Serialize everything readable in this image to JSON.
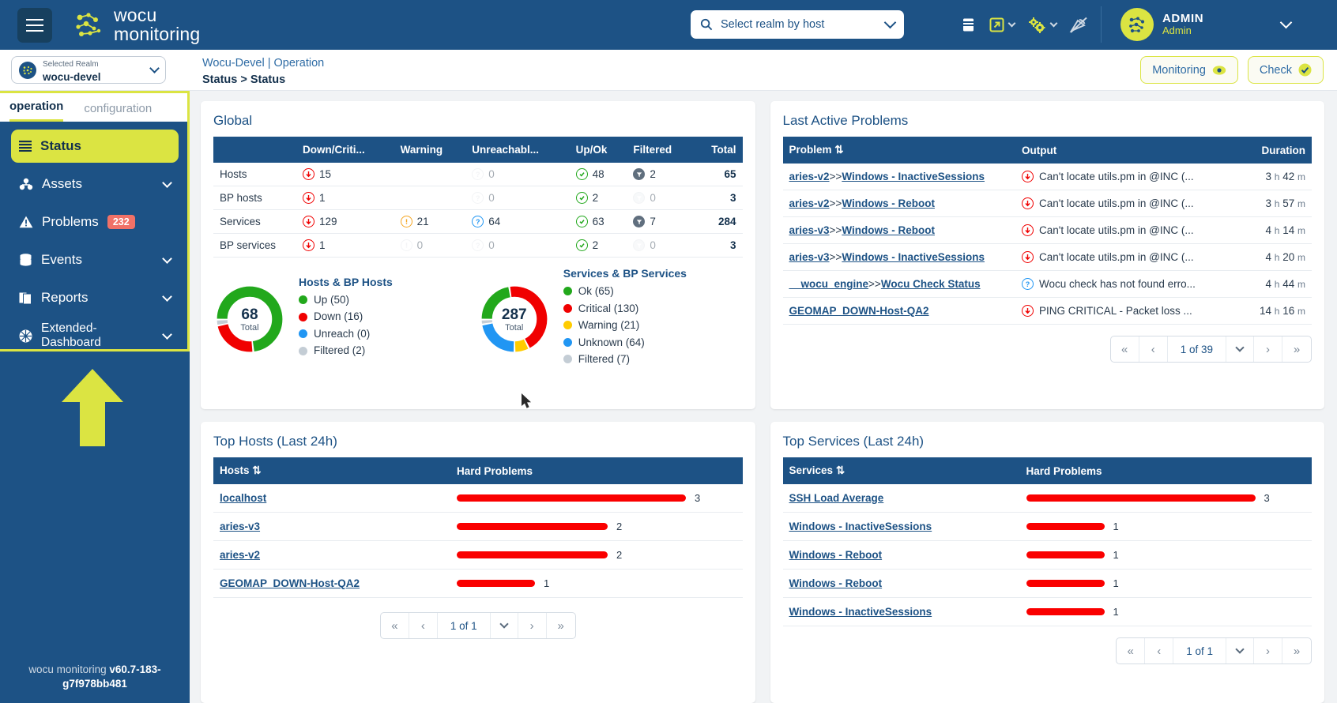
{
  "header": {
    "brand_line1": "wocu",
    "brand_line2": "monitoring",
    "search_placeholder": "Select realm by host",
    "icons": {
      "menu": "hamburger-menu-icon",
      "search": "search-icon",
      "book": "book-icon",
      "external": "external-link-icon",
      "gears": "gears-icon",
      "satellite": "satellite-off-icon"
    },
    "user_name": "ADMIN",
    "user_role": "Admin"
  },
  "subheader": {
    "realm_label": "Selected Realm",
    "realm_value": "wocu-devel",
    "breadcrumb_top": "Wocu-Devel | Operation",
    "breadcrumb_bottom": "Status > Status",
    "btn_monitoring": "Monitoring",
    "btn_check": "Check"
  },
  "sidebar": {
    "tabs": [
      {
        "label": "operation",
        "active": true
      },
      {
        "label": "configuration",
        "active": false
      }
    ],
    "items": [
      {
        "label": "Status",
        "icon": "list-icon",
        "active": true,
        "badge": null,
        "chevron": false
      },
      {
        "label": "Assets",
        "icon": "assets-icon",
        "active": false,
        "badge": null,
        "chevron": true
      },
      {
        "label": "Problems",
        "icon": "warning-triangle-icon",
        "active": false,
        "badge": "232",
        "chevron": false
      },
      {
        "label": "Events",
        "icon": "database-icon",
        "active": false,
        "badge": null,
        "chevron": true
      },
      {
        "label": "Reports",
        "icon": "document-icon",
        "active": false,
        "badge": null,
        "chevron": true
      },
      {
        "label": "Extended-Dashboard",
        "icon": "dashboard-icon",
        "active": false,
        "badge": null,
        "chevron": true
      }
    ],
    "version_prefix": "wocu monitoring ",
    "version": "v60.7-183-g7f978bb481"
  },
  "global": {
    "title": "Global",
    "columns": [
      "",
      "Down/Criti...",
      "Warning",
      "Unreachabl...",
      "Up/Ok",
      "Filtered",
      "Total"
    ],
    "rows": [
      {
        "name": "Hosts",
        "down": "15",
        "warning": "",
        "unreach": "0",
        "up": "48",
        "filtered": "2",
        "total": "65"
      },
      {
        "name": "BP hosts",
        "down": "1",
        "warning": "",
        "unreach": "0",
        "up": "2",
        "filtered": "0",
        "total": "3"
      },
      {
        "name": "Services",
        "down": "129",
        "warning": "21",
        "unreach": "64",
        "up": "63",
        "filtered": "7",
        "total": "284"
      },
      {
        "name": "BP services",
        "down": "1",
        "warning": "0",
        "unreach": "0",
        "up": "2",
        "filtered": "0",
        "total": "3"
      }
    ]
  },
  "chart_data": [
    {
      "type": "pie",
      "title": "Hosts & BP Hosts",
      "center_value": "68",
      "center_label": "Total",
      "categories": [
        "Up",
        "Down",
        "Unreach",
        "Filtered"
      ],
      "values": [
        50,
        16,
        0,
        2
      ],
      "labels": [
        "Up (50)",
        "Down (16)",
        "Unreach (0)",
        "Filtered (2)"
      ],
      "colors": [
        "#22a81c",
        "#f00000",
        "#2196f3",
        "#c4cdd5"
      ],
      "legend": "right"
    },
    {
      "type": "pie",
      "title": "Services & BP Services",
      "center_value": "287",
      "center_label": "Total",
      "categories": [
        "Ok",
        "Critical",
        "Warning",
        "Unknown",
        "Filtered"
      ],
      "values": [
        65,
        130,
        21,
        64,
        7
      ],
      "labels": [
        "Ok (65)",
        "Critical (130)",
        "Warning (21)",
        "Unknown (64)",
        "Filtered (7)"
      ],
      "colors": [
        "#22a81c",
        "#f00000",
        "#ffcc00",
        "#2196f3",
        "#c4cdd5"
      ],
      "legend": "right"
    }
  ],
  "problems": {
    "title": "Last Active Problems",
    "columns": [
      "Problem",
      "Output",
      "Duration"
    ],
    "rows": [
      {
        "host": "aries-v2",
        "sep": ">>",
        "service": "Windows - InactiveSessions",
        "status": "critical",
        "output": "Can't locate utils.pm in @INC (...",
        "hours": "3",
        "mins": "42"
      },
      {
        "host": "aries-v2",
        "sep": ">>",
        "service": "Windows - Reboot",
        "status": "critical",
        "output": "Can't locate utils.pm in @INC (...",
        "hours": "3",
        "mins": "57"
      },
      {
        "host": "aries-v3",
        "sep": ">>",
        "service": "Windows - Reboot",
        "status": "critical",
        "output": "Can't locate utils.pm in @INC (...",
        "hours": "4",
        "mins": "14"
      },
      {
        "host": "aries-v3",
        "sep": ">>",
        "service": "Windows - InactiveSessions",
        "status": "critical",
        "output": "Can't locate utils.pm in @INC (...",
        "hours": "4",
        "mins": "20"
      },
      {
        "host": "__wocu_engine",
        "sep": ">>",
        "service": "Wocu Check Status",
        "status": "unknown",
        "output": "Wocu check has not found erro...",
        "hours": "4",
        "mins": "44"
      },
      {
        "host": "GEOMAP_DOWN-Host-QA2",
        "sep": "",
        "service": "",
        "status": "critical",
        "output": "PING CRITICAL - Packet loss ...",
        "hours": "14",
        "mins": "16"
      }
    ],
    "pager": {
      "label": "1 of 39"
    }
  },
  "top_hosts": {
    "title": "Top Hosts (Last 24h)",
    "columns": [
      "Hosts",
      "Hard Problems"
    ],
    "rows": [
      {
        "name": "localhost",
        "value": "3",
        "pct": 100
      },
      {
        "name": "aries-v3",
        "value": "2",
        "pct": 66
      },
      {
        "name": "aries-v2",
        "value": "2",
        "pct": 66
      },
      {
        "name": "GEOMAP_DOWN-Host-QA2",
        "value": "1",
        "pct": 34
      }
    ],
    "pager": {
      "label": "1 of 1"
    }
  },
  "top_services": {
    "title": "Top Services (Last 24h)",
    "columns": [
      "Services",
      "Hard Problems"
    ],
    "rows": [
      {
        "name": "SSH Load Average",
        "value": "3",
        "pct": 100
      },
      {
        "name": "Windows - InactiveSessions",
        "value": "1",
        "pct": 34
      },
      {
        "name": "Windows - Reboot",
        "value": "1",
        "pct": 34
      },
      {
        "name": "Windows - Reboot",
        "value": "1",
        "pct": 34
      },
      {
        "name": "Windows - InactiveSessions",
        "value": "1",
        "pct": 34
      }
    ],
    "pager": {
      "label": "1 of 1"
    }
  },
  "colors": {
    "brand_blue": "#1d5285",
    "accent_yellow": "#dbe442",
    "critical_red": "#f00000",
    "ok_green": "#22a81c",
    "warning_yellow": "#ffcc00",
    "unknown_blue": "#2196f3",
    "filtered_gray": "#c4cdd5",
    "badge_red": "#f07167"
  }
}
